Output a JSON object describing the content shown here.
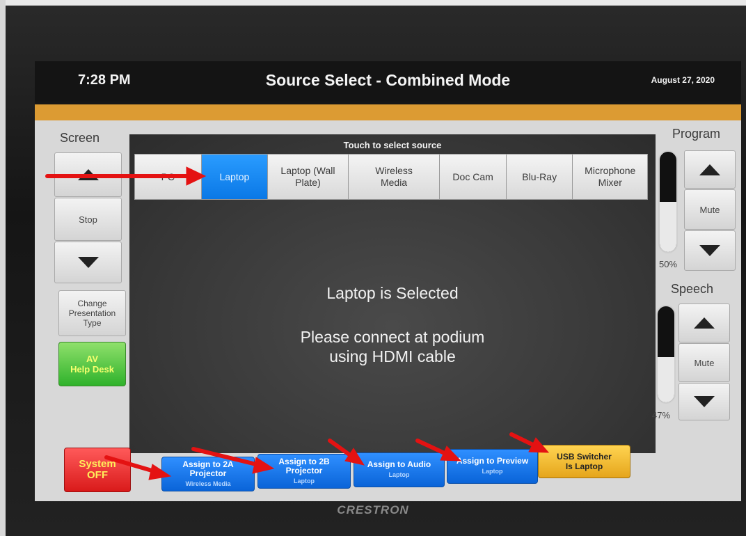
{
  "header": {
    "time": "7:28 PM",
    "title": "Source Select - Combined Mode",
    "date": "August 27, 2020"
  },
  "screen": {
    "label": "Screen",
    "stop_label": "Stop",
    "change_presentation_label": "Change Presentation Type",
    "help_desk_label_line1": "AV",
    "help_desk_label_line2": "Help Desk"
  },
  "sources": {
    "prompt": "Touch to select source",
    "tabs": [
      {
        "label": "PC",
        "selected": false
      },
      {
        "label": "Laptop",
        "selected": true
      },
      {
        "label": "Laptop (Wall Plate)",
        "selected": false
      },
      {
        "label": "Wireless Media",
        "selected": false
      },
      {
        "label": "Doc Cam",
        "selected": false
      },
      {
        "label": "Blu-Ray",
        "selected": false
      },
      {
        "label": "Microphone Mixer",
        "selected": false
      }
    ]
  },
  "message": {
    "line1": "Laptop is Selected",
    "line2": "Please connect at podium",
    "line3": "using HDMI cable"
  },
  "program": {
    "label": "Program",
    "mute_label": "Mute",
    "level_text": "50%",
    "level": 0.5
  },
  "speech": {
    "label": "Speech",
    "mute_label": "Mute",
    "level_text": "47%",
    "level": 0.47
  },
  "bottom": {
    "system_off_line1": "System",
    "system_off_line2": "OFF",
    "assign_2a": {
      "line1": "Assign to 2A",
      "line2": "Projector",
      "sub": "Wireless Media"
    },
    "assign_2b": {
      "line1": "Assign to 2B",
      "line2": "Projector",
      "sub": "Laptop"
    },
    "assign_audio": {
      "line1": "Assign to Audio",
      "sub": "Laptop"
    },
    "assign_preview": {
      "line1": "Assign to Preview",
      "sub": "Laptop"
    },
    "usb_switcher": {
      "line1": "USB Switcher",
      "line2": "Is Laptop"
    }
  },
  "brand": "CRESTRON",
  "colors": {
    "accent_orange": "#dc9b33",
    "selected_blue": "#0a78e6",
    "help_green": "#2fb22b",
    "power_red": "#d91a1a",
    "usb_yellow": "#e5a51c",
    "annotation_red": "#e41212"
  }
}
